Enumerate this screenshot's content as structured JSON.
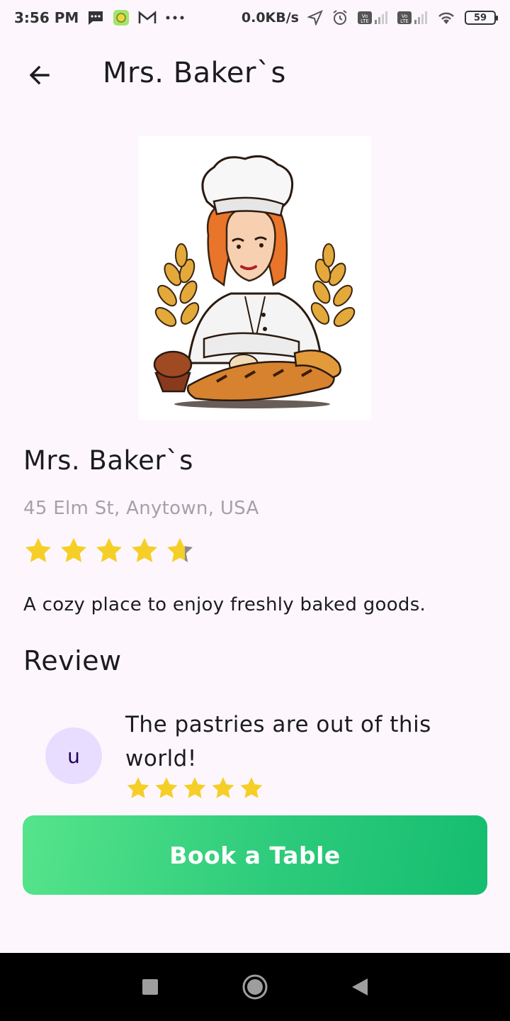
{
  "status_bar": {
    "time": "3:56 PM",
    "net_speed": "0.0KB/s",
    "battery": "59",
    "icons": [
      "message-icon",
      "app-icon",
      "gmail-icon",
      "more-dots-icon",
      "location-arrow-icon",
      "alarm-icon",
      "volte-icon",
      "signal-icon",
      "volte-icon",
      "signal-icon",
      "wifi-icon",
      "battery-icon"
    ]
  },
  "app_bar": {
    "title": "Mrs. Baker`s",
    "back_icon": "arrow-left-icon"
  },
  "place": {
    "name": "Mrs. Baker`s",
    "address": "45 Elm St, Anytown, USA",
    "rating": 4.7,
    "rating_max": 5,
    "description": "A cozy place to enjoy freshly baked goods."
  },
  "review_section": {
    "heading": "Review",
    "items": [
      {
        "avatar_initial": "u",
        "text": "The pastries are out of this world!",
        "rating": 5
      }
    ]
  },
  "book_button": {
    "label": "Book a Table"
  },
  "colors": {
    "background": "#fdf7fd",
    "star": "#f5cf28",
    "button_start": "#56e48b",
    "button_end": "#16bd6f",
    "avatar_bg": "#e9ddff",
    "address_text": "#a5a1a8"
  }
}
